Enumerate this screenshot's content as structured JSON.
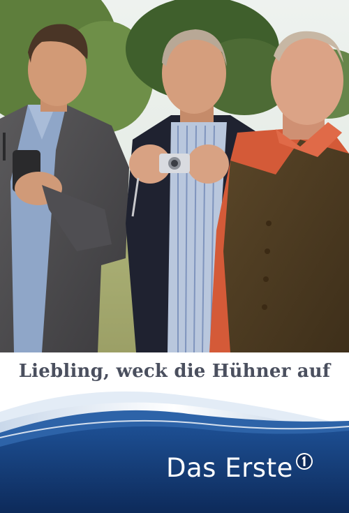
{
  "title": "Liebling, weck die Hühner auf",
  "channel": {
    "name": "Das Erste",
    "logo_icon": "das-erste-1-logo-icon",
    "logo_text": "1"
  },
  "colors": {
    "title_text": "#4a4f5e",
    "banner_dark": "#0d2a5a",
    "banner_mid": "#1d4f93",
    "banner_light": "#d7e3f0"
  }
}
